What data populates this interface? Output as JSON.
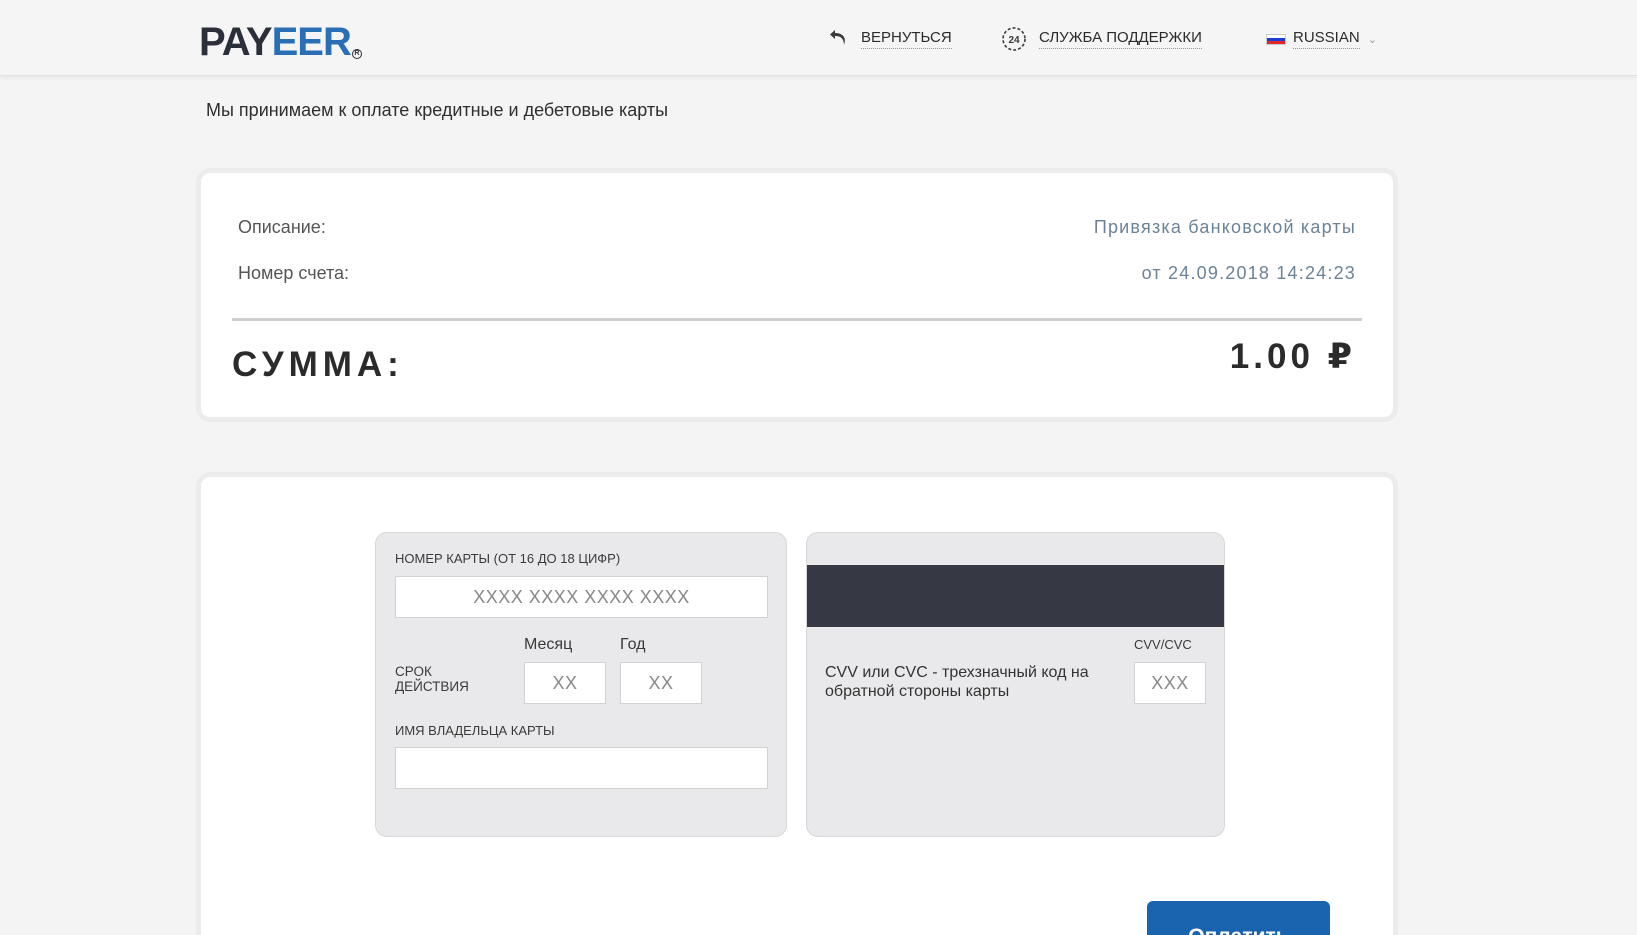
{
  "header": {
    "logo_part1": "PAY",
    "logo_part2": "EER",
    "logo_reg": "R",
    "back_label": "ВЕРНУТЬСЯ",
    "support_label": "СЛУЖБА ПОДДЕРЖКИ",
    "support_icon_text": "24",
    "language_label": "RUSSIAN"
  },
  "accept_note": "Мы принимаем к оплате кредитные и дебетовые карты",
  "summary": {
    "description_label": "Описание:",
    "description_value": "Привязка банковской карты",
    "account_label": "Номер счета:",
    "account_value": "от 24.09.2018 14:24:23",
    "total_label": "СУММА:",
    "total_value": "1.00 ₽"
  },
  "card_front": {
    "number_label": "НОМЕР КАРТЫ (ОТ 16 ДО 18 ЦИФР)",
    "number_placeholder": "XXXX XXXX XXXX XXXX",
    "expiry_label": "СРОК ДЕЙСТВИЯ",
    "month_label": "Месяц",
    "month_placeholder": "XX",
    "year_label": "Год",
    "year_placeholder": "XX",
    "holder_label": "ИМЯ ВЛАДЕЛЬЦА КАРТЫ",
    "holder_value": ""
  },
  "card_back": {
    "cvv_label": "CVV/CVC",
    "cvv_placeholder": "XXX",
    "cvv_description": "CVV или CVC - трехзначный код на обратной стороны карты"
  },
  "pay_button_label": "Оплатить",
  "colors": {
    "brand_dark": "#2b2f3a",
    "brand_blue": "#2a6fb5",
    "button": "#1a63ae",
    "stripe": "#363843"
  }
}
